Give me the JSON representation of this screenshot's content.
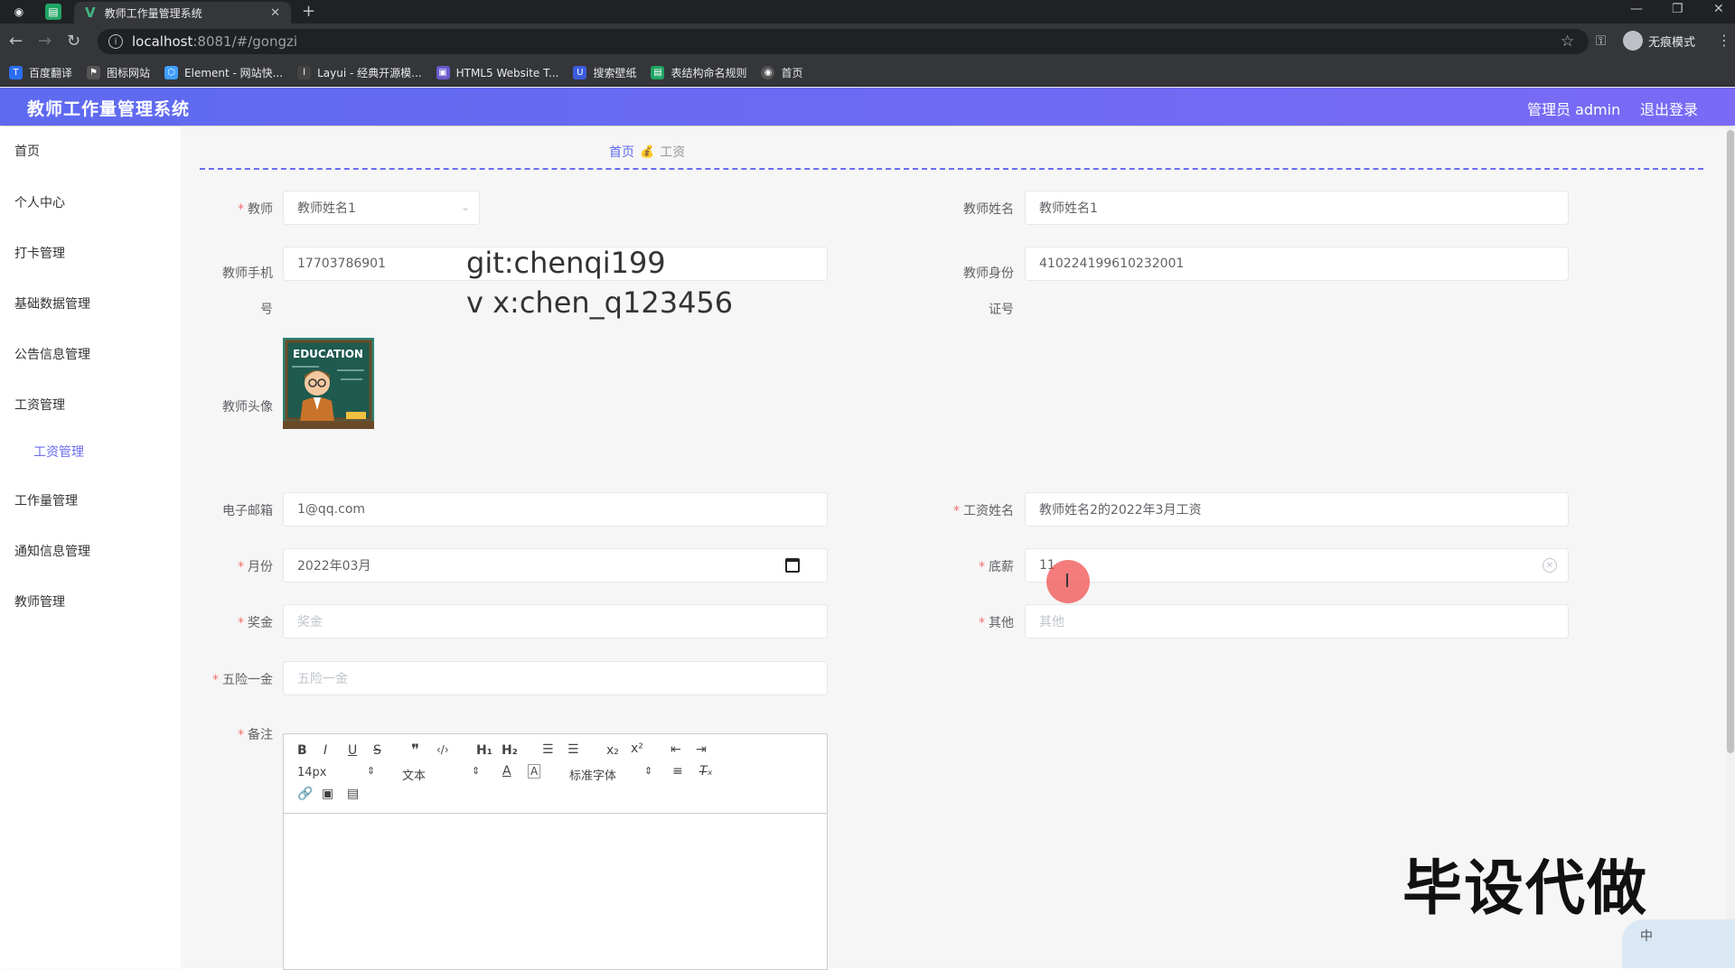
{
  "browser": {
    "tab_title": "教师工作量管理系统",
    "url_host": "localhost",
    "url_path": ":8081/#/gongzi",
    "profile_label": "无痕模式",
    "bookmarks": [
      "百度翻译",
      "图标网站",
      "Element - 网站快...",
      "Layui - 经典开源模...",
      "HTML5 Website T...",
      "搜索壁纸",
      "表结构命名规则",
      "首页"
    ]
  },
  "header": {
    "title": "教师工作量管理系统",
    "admin": "管理员 admin",
    "logout": "退出登录"
  },
  "sidebar": {
    "items": [
      "首页",
      "个人中心",
      "打卡管理",
      "基础数据管理",
      "公告信息管理",
      "工资管理",
      "工作量管理",
      "通知信息管理",
      "教师管理"
    ],
    "active_sub": "工资管理"
  },
  "breadcrumb": {
    "home": "首页",
    "current": "工资"
  },
  "form": {
    "teacher_label": "教师",
    "teacher_value": "教师姓名1",
    "teacher_name_label": "教师姓名",
    "teacher_name_value": "教师姓名1",
    "phone_label": "教师手机号",
    "phone_value": "17703786901",
    "idcard_label": "教师身份证号",
    "idcard_value": "410224199610232001",
    "avatar_label": "教师头像",
    "email_label": "电子邮箱",
    "email_value": "1@qq.com",
    "salary_name_label": "工资姓名",
    "salary_name_value": "教师姓名2的2022年3月工资",
    "month_label": "月份",
    "month_value": "2022年03月",
    "base_label": "底薪",
    "base_value": "11",
    "bonus_label": "奖金",
    "bonus_placeholder": "奖金",
    "other_label": "其他",
    "other_placeholder": "其他",
    "insurance_label": "五险一金",
    "insurance_placeholder": "五险一金",
    "remark_label": "备注"
  },
  "editor": {
    "font_size": "14px",
    "header_select": "文本",
    "font_family": "标准字体"
  },
  "overlay": {
    "git": "git:chenqi199",
    "vx": "v x:chen_q123456",
    "watermark": "毕设代做",
    "ime_char": "中",
    "avatar_caption": "EDUCATION"
  }
}
